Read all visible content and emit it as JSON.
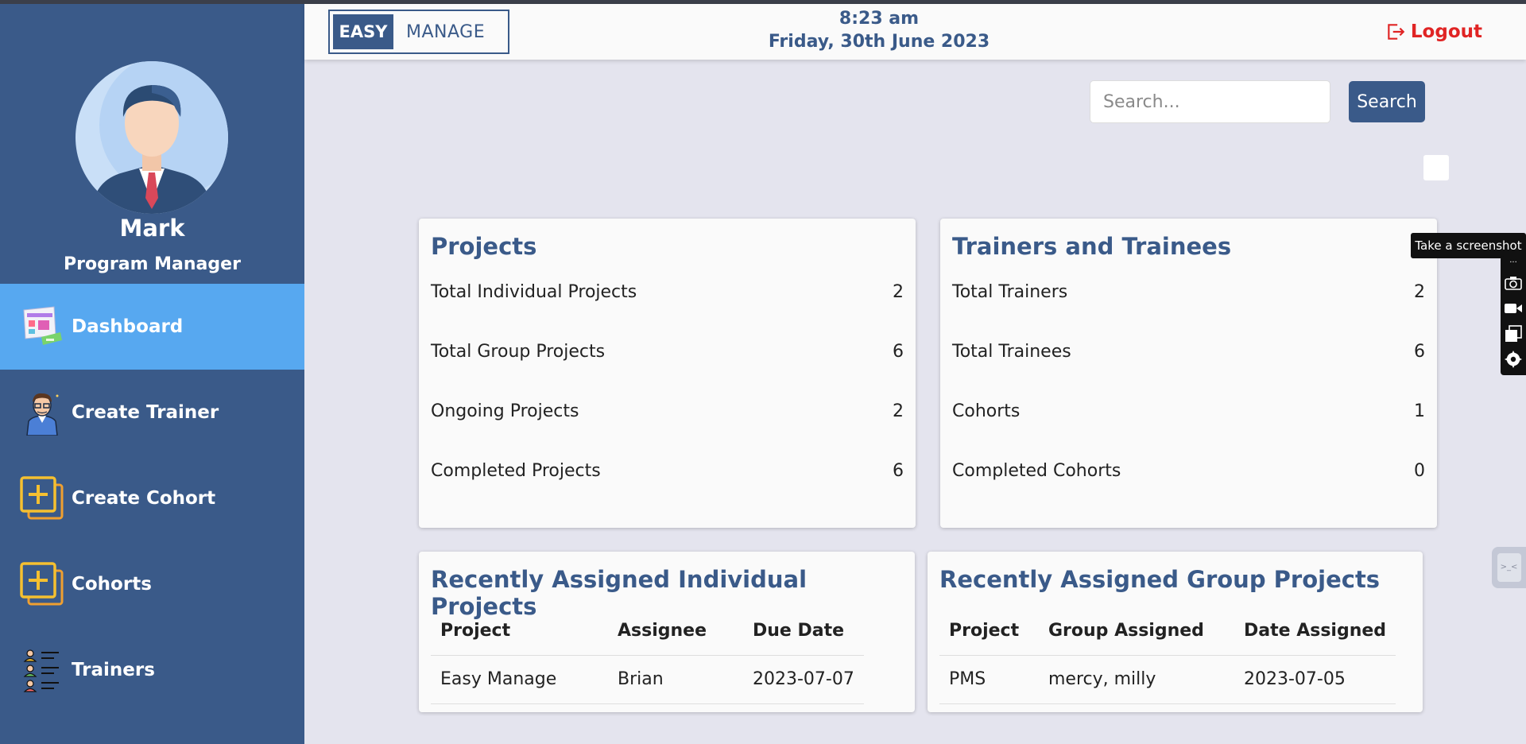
{
  "header": {
    "brand_easy": "EASY",
    "brand_manage": "MANAGE",
    "time": "8:23 am",
    "date": "Friday, 30th June 2023",
    "logout_label": "Logout"
  },
  "sidebar": {
    "user_name": "Mark",
    "user_role": "Program Manager",
    "items": [
      {
        "label": "Dashboard",
        "icon": "dashboard-icon",
        "active": true
      },
      {
        "label": "Create Trainer",
        "icon": "trainer-icon",
        "active": false
      },
      {
        "label": "Create Cohort",
        "icon": "add-cohort-icon",
        "active": false
      },
      {
        "label": "Cohorts",
        "icon": "cohorts-icon",
        "active": false
      },
      {
        "label": "Trainers",
        "icon": "trainers-list-icon",
        "active": false
      }
    ]
  },
  "search": {
    "placeholder": "Search...",
    "button_label": "Search"
  },
  "projects_card": {
    "title": "Projects",
    "rows": [
      {
        "label": "Total Individual Projects",
        "value": "2"
      },
      {
        "label": "Total Group Projects",
        "value": "6"
      },
      {
        "label": "Ongoing Projects",
        "value": "2"
      },
      {
        "label": "Completed Projects",
        "value": "6"
      }
    ]
  },
  "trainers_card": {
    "title": "Trainers and Trainees",
    "rows": [
      {
        "label": "Total Trainers",
        "value": "2"
      },
      {
        "label": "Total Trainees",
        "value": "6"
      },
      {
        "label": "Cohorts",
        "value": "1"
      },
      {
        "label": "Completed Cohorts",
        "value": "0"
      }
    ]
  },
  "individual_projects": {
    "title": "Recently Assigned Individual Projects",
    "columns": [
      "Project",
      "Assignee",
      "Due Date"
    ],
    "rows": [
      [
        "Easy Manage",
        "Brian",
        "2023-07-07"
      ]
    ]
  },
  "group_projects": {
    "title": "Recently Assigned Group Projects",
    "columns": [
      "Project",
      "Group Assigned",
      "Date Assigned"
    ],
    "rows": [
      [
        "PMS",
        "mercy, milly",
        "2023-07-05"
      ]
    ]
  },
  "screenshot_tool": {
    "tooltip": "Take a screenshot"
  },
  "colors": {
    "sidebar": "#3a5a89",
    "active_nav": "#57a8f0",
    "accent": "#3a5a89",
    "logout": "#e02424",
    "background": "#e4e4ee"
  }
}
